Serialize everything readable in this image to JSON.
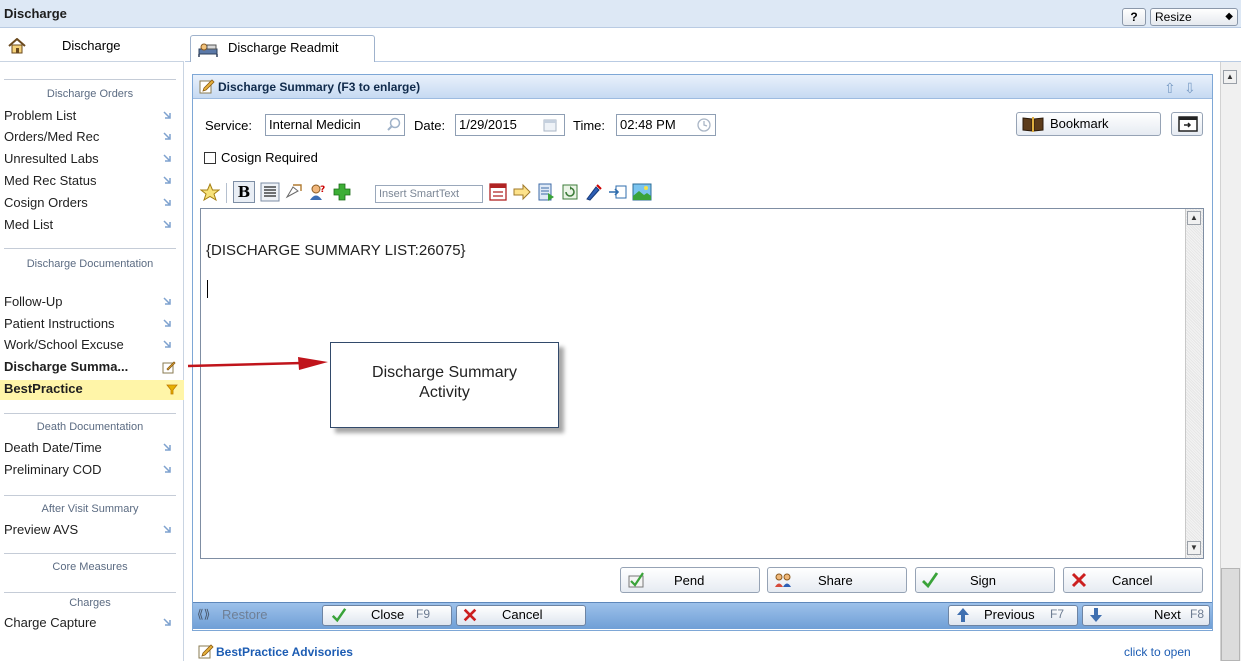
{
  "app": {
    "title": "Discharge"
  },
  "window_controls": {
    "help_label": "?",
    "resize_label": "Resize",
    "resize_arrows": "◆"
  },
  "sidebar": {
    "tab_label": "Discharge",
    "sections": [
      {
        "heading": "Discharge Orders"
      },
      {
        "heading": "Discharge Documentation"
      },
      {
        "heading": "Death Documentation"
      },
      {
        "heading": "After Visit Summary"
      },
      {
        "heading": "Core Measures"
      },
      {
        "heading": "Charges"
      }
    ],
    "items": [
      {
        "label": "Problem List"
      },
      {
        "label": "Orders/Med Rec"
      },
      {
        "label": "Unresulted Labs"
      },
      {
        "label": "Med Rec Status"
      },
      {
        "label": "Cosign Orders"
      },
      {
        "label": "Med List"
      },
      {
        "label": "Follow-Up"
      },
      {
        "label": "Patient Instructions"
      },
      {
        "label": "Work/School Excuse"
      },
      {
        "label": "Discharge Summa..."
      },
      {
        "label": "BestPractice"
      },
      {
        "label": "Death Date/Time"
      },
      {
        "label": "Preliminary COD"
      },
      {
        "label": "Preview AVS"
      },
      {
        "label": "Charge Capture"
      }
    ]
  },
  "tabs": [
    {
      "label": "Discharge Readmit"
    }
  ],
  "panel": {
    "title": "Discharge Summary (F3 to enlarge)",
    "service_label": "Service:",
    "service_value": "Internal Medicin",
    "date_label": "Date:",
    "date_value": "1/29/2015",
    "time_label": "Time:",
    "time_value": "02:48 PM",
    "bookmark_label": "Bookmark",
    "cosign_label": "Cosign Required",
    "smarttext_placeholder": "Insert SmartText",
    "editor_text": "{DISCHARGE SUMMARY LIST:26075}"
  },
  "callout": {
    "line1": "Discharge Summary",
    "line2": "Activity"
  },
  "actions": [
    {
      "label": "Pend"
    },
    {
      "label": "Share"
    },
    {
      "label": "Sign"
    },
    {
      "label": "Cancel"
    }
  ],
  "bottom_bar": {
    "restore_label": "Restore",
    "close_label": "Close",
    "close_key": "F9",
    "cancel_label": "Cancel",
    "previous_label": "Previous",
    "previous_key": "F7",
    "next_label": "Next",
    "next_key": "F8"
  },
  "advisories": {
    "title": "BestPractice Advisories",
    "link": "click to open"
  },
  "colors": {
    "header_blue": "#c6daf2",
    "bar_blue": "#6f9fd6",
    "highlight_yellow": "#fff5a8",
    "arrow_red": "#c0141b",
    "link_blue": "#1c5cb3"
  }
}
